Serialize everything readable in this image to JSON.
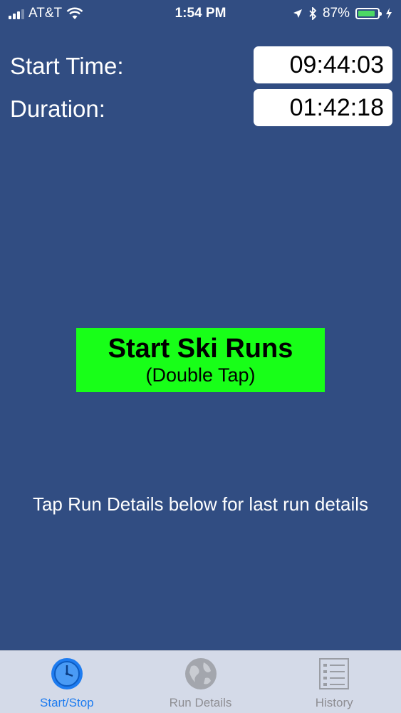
{
  "status_bar": {
    "carrier": "AT&T",
    "time": "1:54 PM",
    "battery_percent": "87%",
    "battery_level": 0.87,
    "icons": [
      "signal-icon",
      "wifi-icon",
      "location-icon",
      "bluetooth-icon",
      "battery-icon",
      "charging-icon"
    ]
  },
  "info": {
    "start_time_label": "Start Time:",
    "start_time_value": "09:44:03",
    "duration_label": "Duration:",
    "duration_value": "01:42:18"
  },
  "start_button": {
    "title": "Start Ski Runs",
    "subtitle": "(Double Tap)",
    "color": "#18ff18"
  },
  "hint_text": "Tap Run Details below for last run details",
  "tab_bar": {
    "tabs": [
      {
        "label": "Start/Stop",
        "icon": "clock-icon",
        "active": true
      },
      {
        "label": "Run Details",
        "icon": "globe-icon",
        "active": false
      },
      {
        "label": "History",
        "icon": "list-icon",
        "active": false
      }
    ]
  },
  "colors": {
    "background": "#314d82",
    "tab_active": "#1e7cf0",
    "tab_inactive": "#8e8e93"
  }
}
